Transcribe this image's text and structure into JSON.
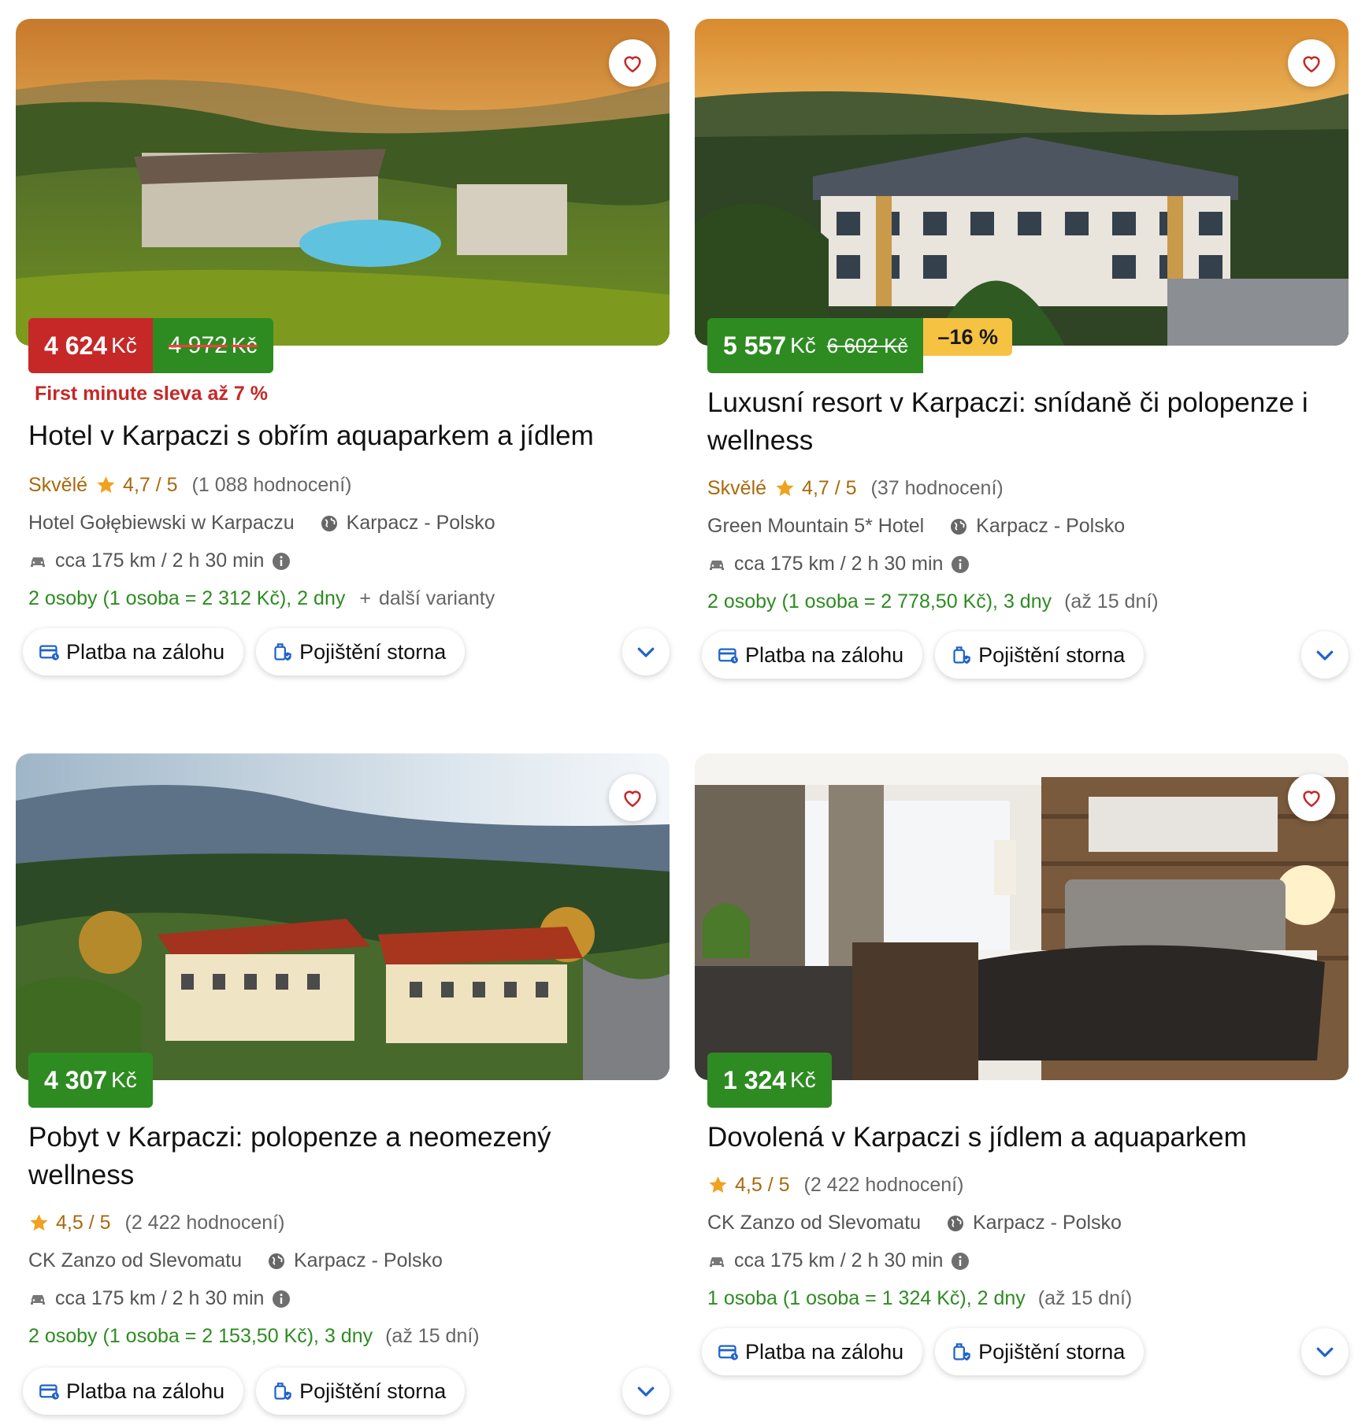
{
  "currency": "Kč",
  "colors": {
    "price_green": "#2e8b22",
    "price_red": "#c62828",
    "discount_yellow": "#f5c242",
    "rating_amber": "#a9690c",
    "offer_green": "#2e8b22"
  },
  "chips": {
    "payment": "Platba na zálohu",
    "insurance": "Pojištění storna"
  },
  "icons": {
    "favorite": "heart-icon",
    "rating": "star-icon",
    "location": "globe-icon",
    "distance": "car-icon",
    "info": "info-icon",
    "payment": "credit-card-icon",
    "insurance": "luggage-shield-icon",
    "expand": "chevron-down-icon"
  },
  "cards": [
    {
      "price": "4 624",
      "old_price": "4 972",
      "discount": "",
      "promo": "First minute sleva až 7 %",
      "title": "Hotel v Karpaczi s obřím aquaparkem a jídlem",
      "rating_word": "Skvělé",
      "rating_score": "4,7 / 5",
      "rating_count": "(1 088 hodnocení)",
      "provider": "Hotel Gołębiewski w Karpaczu",
      "location": "Karpacz - Polsko",
      "distance": "cca 175 km / 2 h 30 min",
      "offer": "2 osoby (1 osoba = 2 312 Kč), 2 dny",
      "offer_extra": "další varianty",
      "offer_note": ""
    },
    {
      "price": "5 557",
      "old_price": "6 602",
      "discount": "–16 %",
      "promo": "",
      "title": "Luxusní resort v Karpaczi: snídaně či polopenze i wellness",
      "rating_word": "Skvělé",
      "rating_score": "4,7 / 5",
      "rating_count": "(37 hodnocení)",
      "provider": "Green Mountain 5* Hotel",
      "location": "Karpacz - Polsko",
      "distance": "cca 175 km / 2 h 30 min",
      "offer": "2 osoby (1 osoba = 2 778,50 Kč), 3 dny",
      "offer_extra": "",
      "offer_note": "(až 15 dní)"
    },
    {
      "price": "4 307",
      "old_price": "",
      "discount": "",
      "promo": "",
      "title": "Pobyt v Karpaczi: polopenze a neomezený wellness",
      "rating_word": "",
      "rating_score": "4,5 / 5",
      "rating_count": "(2 422 hodnocení)",
      "provider": "CK Zanzo od Slevomatu",
      "location": "Karpacz - Polsko",
      "distance": "cca 175 km / 2 h 30 min",
      "offer": "2 osoby (1 osoba = 2 153,50 Kč), 3 dny",
      "offer_extra": "",
      "offer_note": "(až 15 dní)"
    },
    {
      "price": "1 324",
      "old_price": "",
      "discount": "",
      "promo": "",
      "title": "Dovolená v Karpaczi s jídlem a aquaparkem",
      "rating_word": "",
      "rating_score": "4,5 / 5",
      "rating_count": "(2 422 hodnocení)",
      "provider": "CK Zanzo od Slevomatu",
      "location": "Karpacz - Polsko",
      "distance": "cca 175 km / 2 h 30 min",
      "offer": "1 osoba (1 osoba = 1 324 Kč), 2 dny",
      "offer_extra": "",
      "offer_note": "(až 15 dní)"
    }
  ]
}
